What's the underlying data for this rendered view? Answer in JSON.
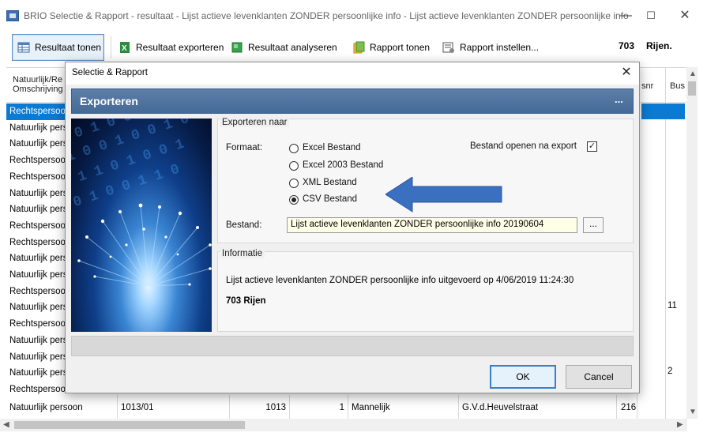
{
  "window": {
    "title": "BRIO Selectie & Rapport - resultaat - Lijst actieve levenklanten ZONDER  persoonlijke info - Lijst actieve levenklanten ZONDER  persoonlijke info",
    "minimize": "—",
    "maximize": "☐",
    "close": "✕"
  },
  "toolbar": {
    "show_result": "Resultaat tonen",
    "export_result": "Resultaat exporteren",
    "analyze_result": "Resultaat analyseren",
    "show_report": "Rapport tonen",
    "configure_report": "Rapport instellen...",
    "row_count": "703",
    "rows_label": "Rijen."
  },
  "grid": {
    "header_first": "Natuurlijk/Re\nOmschrijving",
    "header_snr": "snr",
    "header_bus": "Bus",
    "rows": [
      "Rechtspersoon",
      "Natuurlijk persoon",
      "Natuurlijk persoon",
      "Rechtspersoon",
      "Rechtspersoon",
      "Natuurlijk persoon",
      "Natuurlijk persoon",
      "Rechtspersoon",
      "Rechtspersoon",
      "Natuurlijk persoon",
      "Natuurlijk persoon",
      "Rechtspersoon",
      "Natuurlijk persoon",
      "Rechtspersoon",
      "Natuurlijk persoon",
      "Natuurlijk persoon",
      "Natuurlijk persoon",
      "Rechtspersoon"
    ],
    "right_values": {
      "bus_row13": "11",
      "bus_row17": "2"
    },
    "last_row": {
      "type": "Natuurlijk persoon",
      "code": "1013/01",
      "num": "1013",
      "one": "1",
      "gender": "Mannelijk",
      "street": "G.V.d.Heuvelstraat",
      "nr": "216"
    }
  },
  "dialog": {
    "title": "Selectie & Rapport",
    "close": "✕",
    "banner_title": "Exporteren",
    "banner_more": "...",
    "export_group": "Exporteren naar",
    "format_label": "Formaat:",
    "formats": [
      "Excel Bestand",
      "Excel 2003 Bestand",
      "XML Bestand",
      "CSV Bestand"
    ],
    "selected_format": "CSV Bestand",
    "open_after_export_label": "Bestand openen na export",
    "open_after_export": true,
    "file_label": "Bestand:",
    "file_value": "Lijst actieve levenklanten ZONDER  persoonlijke info 20190604",
    "browse": "...",
    "info_group": "Informatie",
    "info_text": "Lijst actieve levenklanten ZONDER  persoonlijke info uitgevoerd op 4/06/2019 11:24:30",
    "info_rows": "703 Rijen",
    "ok": "OK",
    "cancel": "Cancel"
  },
  "colors": {
    "selection": "#0a7bd4",
    "banner": "#4f729c",
    "arrow": "#3b6fc0",
    "file_bg": "#ffffe8"
  }
}
